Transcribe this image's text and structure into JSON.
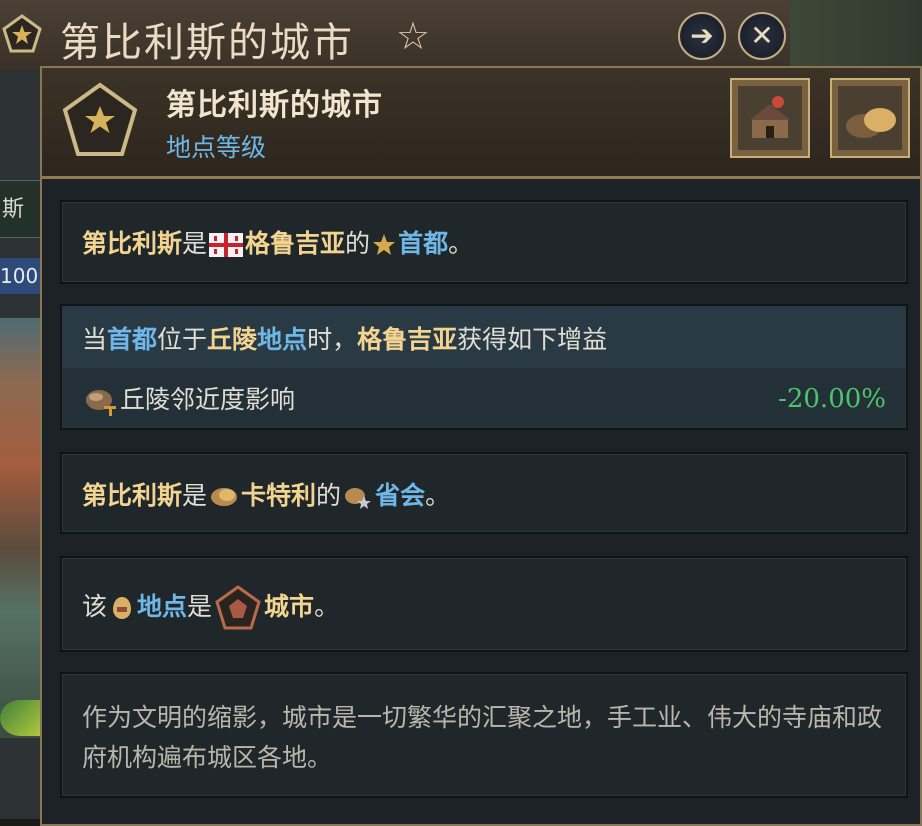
{
  "background_window": {
    "title": "第比利斯的城市",
    "side_tab": "斯",
    "side_number": "100"
  },
  "panel": {
    "title": "第比利斯的城市",
    "subtitle": "地点等级"
  },
  "capital_box": {
    "city": "第比利斯",
    "is": "是",
    "country": "格鲁吉亚",
    "of": "的",
    "capital": "首都",
    "period": "。"
  },
  "bonus_box": {
    "when": "当",
    "capital": "首都",
    "located": "位于",
    "hills": "丘陵",
    "location": "地点",
    "time": "时，",
    "country": "格鲁吉亚",
    "gains": "获得如下增益",
    "modifier_name": "丘陵邻近度影响",
    "modifier_value": "-20.00%"
  },
  "province_box": {
    "city": "第比利斯",
    "is": "是",
    "region": "卡特利",
    "of": "的",
    "seat": "省会",
    "period": "。"
  },
  "location_box": {
    "this": "该",
    "location": "地点",
    "is": "是",
    "type": "城市",
    "period": "。"
  },
  "description": "作为文明的缩影，城市是一切繁华的汇聚之地，手工业、伟大的寺庙和政府机构遍布城区各地。",
  "icons": [
    "star-pentagon-icon",
    "star-icon",
    "arrow-right-icon",
    "close-icon",
    "building-icon",
    "terrain-icon",
    "flag-icon",
    "hills-icon",
    "province-icon",
    "location-pin-icon",
    "city-pentagon-icon"
  ]
}
